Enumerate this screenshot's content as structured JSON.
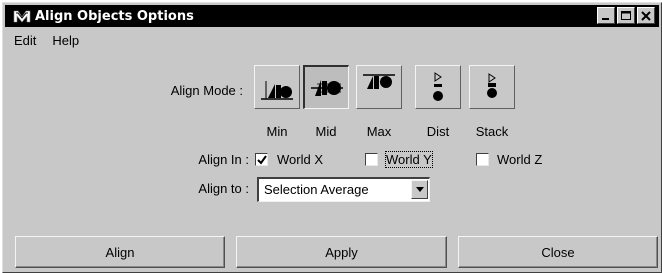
{
  "window": {
    "title": "Align Objects Options",
    "app_icon": "maya-icon",
    "controls": [
      "minimize-icon",
      "maximize-icon",
      "close-icon"
    ]
  },
  "menu": [
    "Edit",
    "Help"
  ],
  "align_mode": {
    "label": "Align Mode :",
    "selected": "Mid",
    "options": [
      {
        "label": "Min",
        "icon": "align-min-icon"
      },
      {
        "label": "Mid",
        "icon": "align-mid-icon"
      },
      {
        "label": "Max",
        "icon": "align-max-icon"
      },
      {
        "label": "Dist",
        "icon": "distribute-icon"
      },
      {
        "label": "Stack",
        "icon": "stack-icon"
      }
    ]
  },
  "align_in": {
    "label": "Align In :",
    "options": [
      {
        "label": "World X",
        "checked": true
      },
      {
        "label": "World Y",
        "checked": false
      },
      {
        "label": "World Z",
        "checked": false
      }
    ]
  },
  "align_to": {
    "label": "Align to :",
    "value": "Selection Average"
  },
  "buttons": {
    "align": "Align",
    "apply": "Apply",
    "close": "Close"
  }
}
